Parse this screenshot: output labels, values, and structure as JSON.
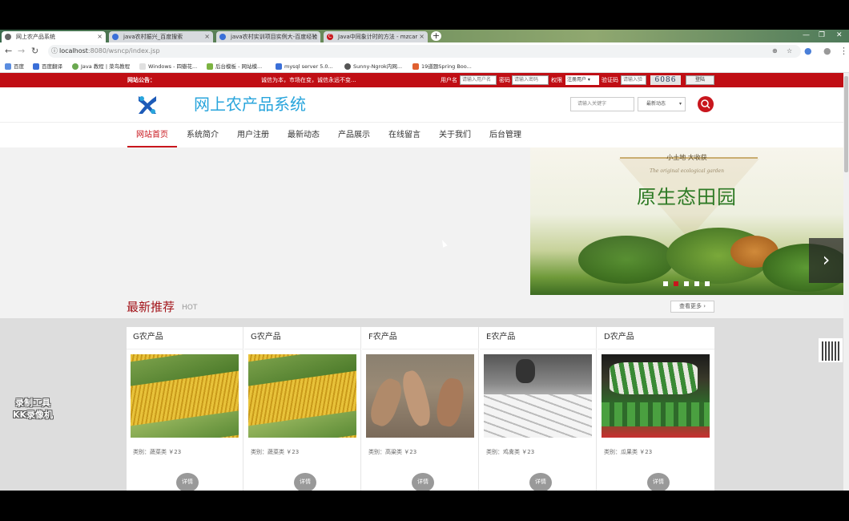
{
  "browser": {
    "tabs": [
      {
        "title": "网上农产品系统",
        "active": true
      },
      {
        "title": "java农村振兴_百度搜索",
        "active": false
      },
      {
        "title": "java农村实训项目实例大-百度经验",
        "active": false
      },
      {
        "title": "Java中同象计时的方法 - mzcar",
        "active": false
      }
    ],
    "url_host": "localhost",
    "url_path": ":8080/wsncp/index.jsp",
    "bookmarks": [
      "百度",
      "百度翻译",
      "Java 教程 | 菜鸟教程",
      "Windows - 四瓣花...",
      "后台模板 - 网站模...",
      "mysql server 5.0...",
      "Sunny-Ngrok内网...",
      "19道题Spring Boo..."
    ]
  },
  "topbar": {
    "notice_label": "网站公告：",
    "notice_text": "诚信为本，市场在变，诚信永远不变...",
    "username_label": "用户名",
    "username_placeholder": "请输入用户名",
    "password_label": "密码",
    "password_placeholder": "请输入密码",
    "role_label": "权限",
    "role_value": "注册用户",
    "captcha_label": "验证码",
    "captcha_placeholder": "请输入验",
    "captcha_code": "6086",
    "login_label": "登陆"
  },
  "header": {
    "site_name": "网上农产品系统",
    "search_placeholder": "请输入关键字",
    "search_type": "最新动态"
  },
  "nav": [
    "网站首页",
    "系统简介",
    "用户注册",
    "最新动态",
    "产品展示",
    "在线留言",
    "关于我们",
    "后台管理"
  ],
  "banner": {
    "line1": "小土地 大收获",
    "line2": "The original ecological garden",
    "line3": "原生态田园",
    "slides": 5,
    "active_slide": 2
  },
  "hot": {
    "title": "最新推荐",
    "subtitle": "HOT",
    "more": "查看更多 ›"
  },
  "products": [
    {
      "name": "G农产品",
      "category": "类别：蔬菜类",
      "price": "￥23",
      "image": "corn"
    },
    {
      "name": "G农产品",
      "category": "类别：蔬菜类",
      "price": "￥23",
      "image": "corn"
    },
    {
      "name": "F农产品",
      "category": "类别：高粱类",
      "price": "￥23",
      "image": "roots"
    },
    {
      "name": "E农产品",
      "category": "类别：鸡禽类",
      "price": "￥23",
      "image": "radish"
    },
    {
      "name": "D农产品",
      "category": "类别：瓜果类",
      "price": "￥23",
      "image": "greens"
    }
  ],
  "detail_label": "详情",
  "watermark": {
    "line1": "录制工具",
    "line2": "KK录像机"
  },
  "colors": {
    "brand_red": "#c00e14",
    "logo_blue": "#29a5dc"
  }
}
